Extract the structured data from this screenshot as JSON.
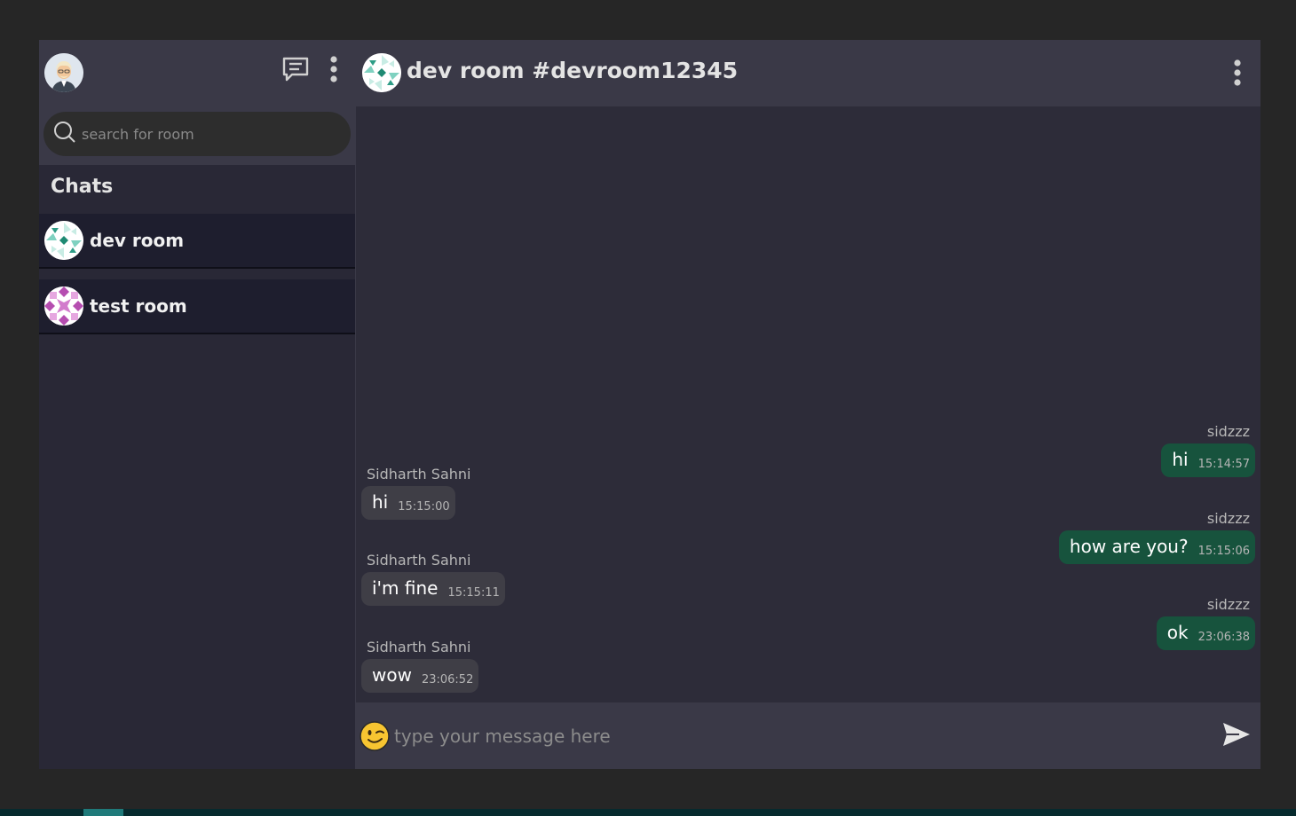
{
  "sidebar": {
    "search_placeholder": "search for room",
    "chats_title": "Chats",
    "rooms": [
      {
        "name": "dev room"
      },
      {
        "name": "test room"
      }
    ]
  },
  "chat": {
    "title": "dev room #devroom12345",
    "composer_placeholder": "type your message here",
    "messages": [
      {
        "sender": "sidzzz",
        "text": "hi",
        "time": "15:14:57",
        "direction": "sent"
      },
      {
        "sender": "Sidharth Sahni",
        "text": "hi",
        "time": "15:15:00",
        "direction": "received"
      },
      {
        "sender": "sidzzz",
        "text": "how are you?",
        "time": "15:15:06",
        "direction": "sent"
      },
      {
        "sender": "Sidharth Sahni",
        "text": "i'm fine",
        "time": "15:15:11",
        "direction": "received"
      },
      {
        "sender": "sidzzz",
        "text": "ok",
        "time": "23:06:38",
        "direction": "sent"
      },
      {
        "sender": "Sidharth Sahni",
        "text": "wow",
        "time": "23:06:52",
        "direction": "received"
      }
    ]
  },
  "icons": {
    "new_chat": "chat-bubble-icon",
    "sidebar_menu": "more-vertical-icon",
    "search": "search-icon",
    "chat_menu": "more-vertical-icon",
    "emoji": "wink-emoji-icon",
    "send": "send-icon"
  },
  "colors": {
    "sent_bubble": "#17533d",
    "received_bubble": "#3f3e46",
    "header": "#3a3947"
  }
}
